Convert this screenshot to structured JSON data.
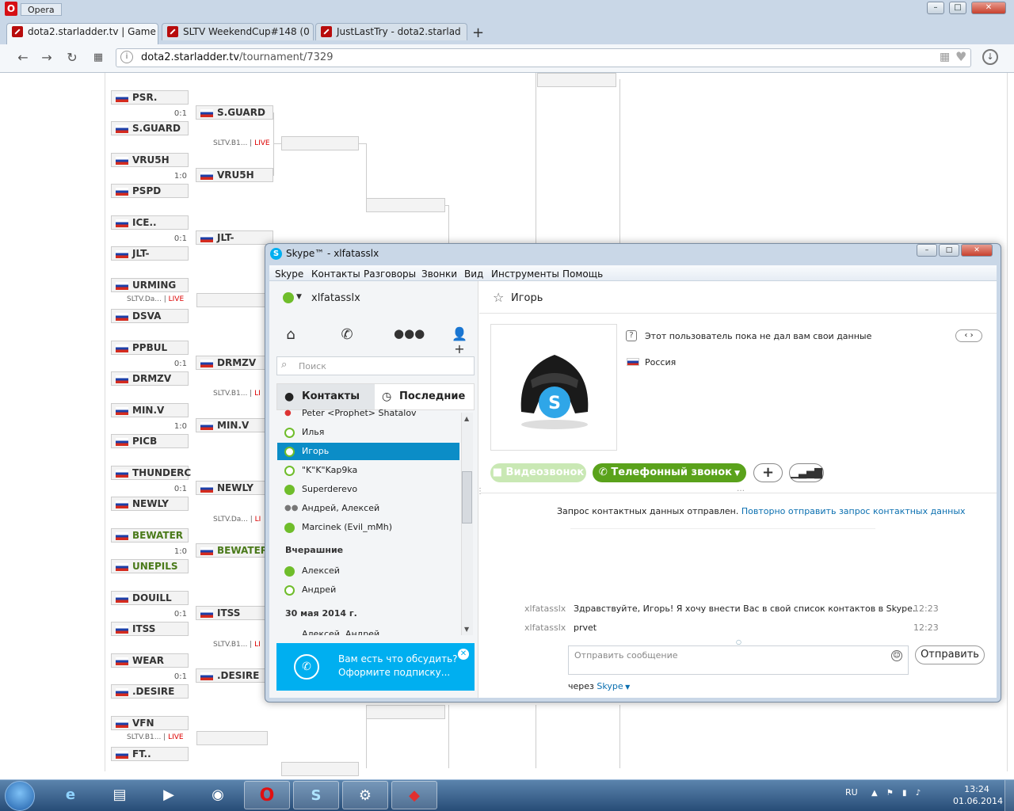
{
  "browser": {
    "app_name": "Opera",
    "tabs": [
      {
        "label": "dota2.starladder.tv | Game"
      },
      {
        "label": "SLTV WeekendCup#148 (0"
      },
      {
        "label": "JustLastTry - dota2.starlad"
      }
    ],
    "address": {
      "host": "dota2.starladder.tv",
      "path": "/tournament/7329"
    }
  },
  "bracket": {
    "round1": [
      {
        "top": "PSR.",
        "bottom": "S.GUARD",
        "score": "0:1"
      },
      {
        "top": "VRU5H",
        "bottom": "PSPD",
        "score": "1:0"
      },
      {
        "top": "ICE..",
        "bottom": "JLT-",
        "score": "0:1"
      },
      {
        "top": "URMING",
        "bottom": "DSVA",
        "live_label": "SLTV.Da...",
        "live": "LIVE"
      },
      {
        "top": "PPBUL",
        "bottom": "DRMZV",
        "score": "0:1"
      },
      {
        "top": "MIN.V",
        "bottom": "PICB",
        "score": "1:0"
      },
      {
        "top": "THUNDERC",
        "bottom": "NEWLY",
        "score": "0:1"
      },
      {
        "top": "BEWATER",
        "bottom": "UNEPILS",
        "score": "1:0"
      },
      {
        "top": "DOUILL",
        "bottom": "ITSS",
        "score": "0:1"
      },
      {
        "top": "WEAR",
        "bottom": ".DESIRE",
        "score": "0:1"
      },
      {
        "top": "VFN",
        "bottom": "FT..",
        "live_label": "SLTV.B1...",
        "live": "LIVE"
      }
    ],
    "round2": [
      {
        "name": "S.GUARD"
      },
      {
        "name": "VRU5H"
      },
      {
        "name": "JLT-"
      },
      {
        "name": "DRMZV"
      },
      {
        "name": "MIN.V"
      },
      {
        "name": "NEWLY"
      },
      {
        "name": "BEWATER"
      },
      {
        "name": "ITSS"
      },
      {
        "name": ".DESIRE"
      }
    ],
    "round2_live": [
      {
        "label": "SLTV.B1...",
        "live": "LIVE"
      },
      {
        "label": "SLTV.B1...",
        "live": "LI"
      },
      {
        "label": "SLTV.Da...",
        "live": "LI"
      },
      {
        "label": "SLTV.B1...",
        "live": "LI"
      }
    ]
  },
  "skype": {
    "title": "Skype™ - xlfatasslx",
    "menu": [
      "Skype",
      "Контакты",
      "Разговоры",
      "Звонки",
      "Вид",
      "Инструменты",
      "Помощь"
    ],
    "username": "xlfatasslx",
    "search_placeholder": "Поиск",
    "tab_contacts": "Контакты",
    "tab_recent": "Последние",
    "contacts": [
      {
        "name": "Peter <Prophet> Shatalov"
      },
      {
        "name": "Илья"
      },
      {
        "name": "Игорь"
      },
      {
        "name": "\"K\"K\"Kap9ka"
      },
      {
        "name": "Superderevo"
      },
      {
        "name": "Андрей, Алексей"
      },
      {
        "name": "Marcinek (Evil_mMh)"
      }
    ],
    "group_yesterday": "Вчерашние",
    "yesterday": [
      {
        "name": "Алексей"
      },
      {
        "name": "Андрей"
      }
    ],
    "group_date": "30 мая 2014 г.",
    "date_items": [
      {
        "name": "Алексей, Андрей"
      }
    ],
    "ad_line1": "Вам есть что обсудить?",
    "ad_line2": "Оформите подписку...",
    "contact_name": "Игорь",
    "info_text": "Этот пользователь пока не дал вам свои данные",
    "country": "Россия",
    "btn_video": "Видеозвонок",
    "btn_phone": "Телефонный звонок",
    "request_text": "Запрос контактных данных отправлен.",
    "request_link": "Повторно отправить запрос контактных данных",
    "messages": [
      {
        "from": "xlfatasslx",
        "text": "Здравствуйте, Игорь! Я хочу внести Вас в свой список контактов в Skype.",
        "time": "12:23"
      },
      {
        "from": "xlfatasslx",
        "text": "prvet",
        "time": "12:23"
      }
    ],
    "input_placeholder": "Отправить сообщение",
    "send_label": "Отправить",
    "via_label": "через",
    "via_link": "Skype"
  },
  "taskbar": {
    "lang": "RU",
    "time": "13:24",
    "date": "01.06.2014"
  }
}
